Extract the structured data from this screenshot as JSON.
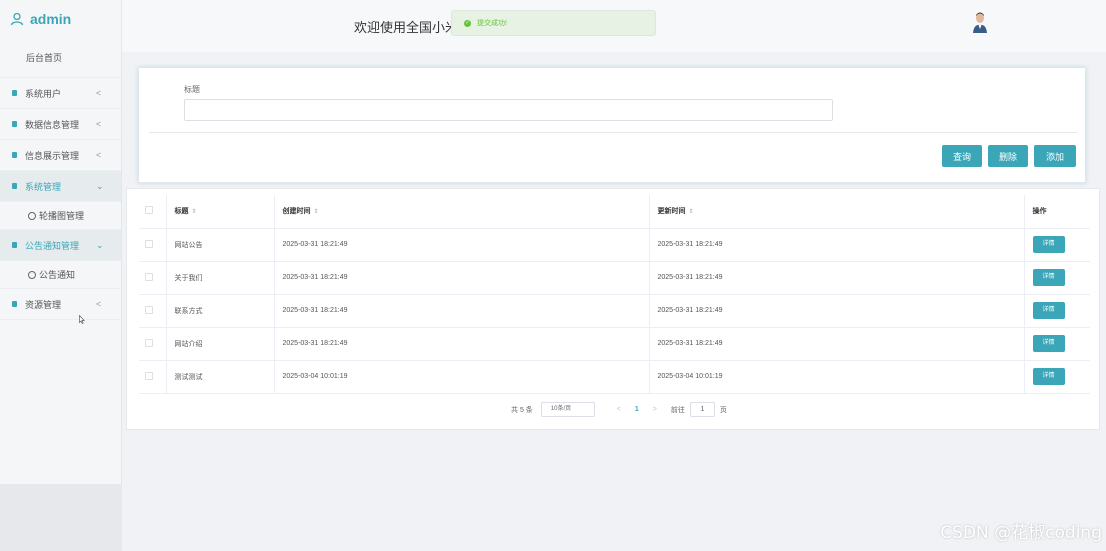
{
  "brand": {
    "name": "admin",
    "icon": "user-icon"
  },
  "sidebar": {
    "home": "后台首页",
    "items": [
      {
        "label": "系统用户",
        "arrow": "<"
      },
      {
        "label": "数据信息管理",
        "arrow": "<"
      },
      {
        "label": "信息展示管理",
        "arrow": "<"
      },
      {
        "label": "系统管理",
        "arrow": "⌄",
        "sub": "轮播图管理"
      },
      {
        "label": "公告通知管理",
        "arrow": "⌄",
        "sub": "公告通知"
      },
      {
        "label": "资源管理",
        "arrow": "<"
      }
    ]
  },
  "header": {
    "title": "欢迎使用全国小米",
    "toast": "提交成功!"
  },
  "search": {
    "label": "标题",
    "value": "",
    "buttons": {
      "query": "查询",
      "delete": "删除",
      "add": "添加"
    }
  },
  "table": {
    "headers": {
      "title": "标题",
      "created": "创建时间",
      "updated": "更新时间",
      "action": "操作"
    },
    "sort_icon": "⇕",
    "rows": [
      {
        "title": "网站公告",
        "created": "2025-03-31 18:21:49",
        "updated": "2025-03-31 18:21:49",
        "action": "详情"
      },
      {
        "title": "关于我们",
        "created": "2025-03-31 18:21:49",
        "updated": "2025-03-31 18:21:49",
        "action": "详情"
      },
      {
        "title": "联系方式",
        "created": "2025-03-31 18:21:49",
        "updated": "2025-03-31 18:21:49",
        "action": "详情"
      },
      {
        "title": "网站介绍",
        "created": "2025-03-31 18:21:49",
        "updated": "2025-03-31 18:21:49",
        "action": "详情"
      },
      {
        "title": "测试测试",
        "created": "2025-03-04 10:01:19",
        "updated": "2025-03-04 10:01:19",
        "action": "详情"
      }
    ]
  },
  "pagination": {
    "total": "共 5 条",
    "page_size": "10条/页",
    "prev": "<",
    "current": "1",
    "next": ">",
    "goto": "前往",
    "goto_value": "1",
    "page_unit": "页"
  },
  "watermark": "CSDN @花椒coding",
  "colors": {
    "accent": "#3aa6b8",
    "success": "#67c23a"
  }
}
